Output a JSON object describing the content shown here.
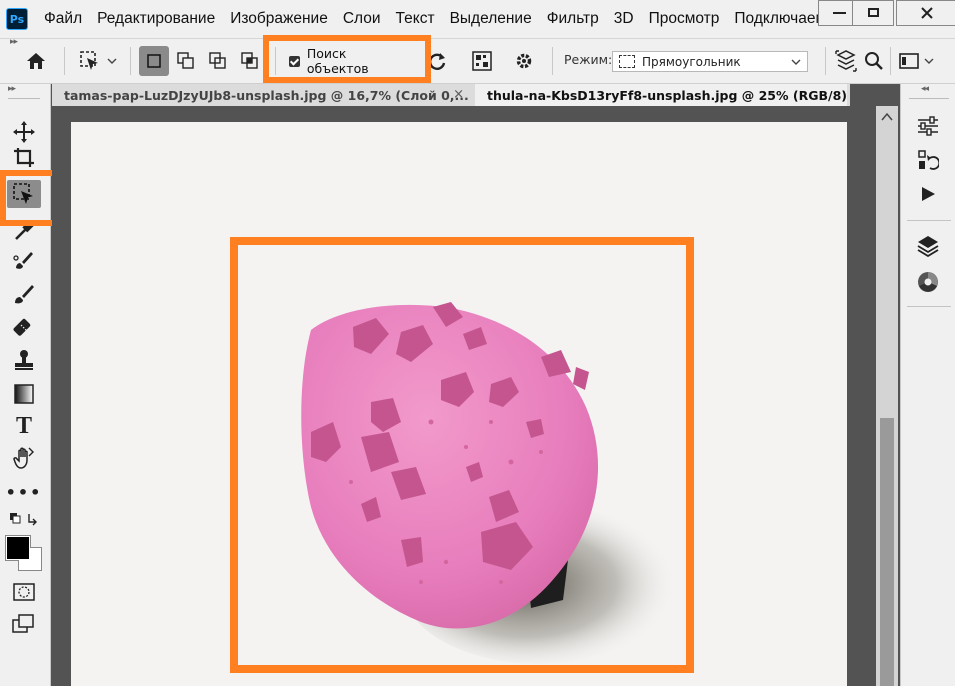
{
  "app": {
    "logo_text": "Ps"
  },
  "menu": [
    "Файл",
    "Редактирование",
    "Изображение",
    "Слои",
    "Текст",
    "Выделение",
    "Фильтр",
    "3D",
    "Просмотр",
    "Подключаемы"
  ],
  "options": {
    "object_finder_label": "Поиск объектов",
    "object_finder_checked": true,
    "mode_label": "Режим:",
    "mode_value": "Прямоугольник"
  },
  "tabs": [
    {
      "label": "tamas-pap-LuzDJzyUJb8-unsplash.jpg @ 16,7% (Слой 0,...",
      "active": false
    },
    {
      "label": "thula-na-KbsD13ryFf8-unsplash.jpg @ 25% (RGB/8)",
      "active": true
    }
  ],
  "highlight_color": "#ff7f21",
  "colors": {
    "foreground": "#000000",
    "background": "#ffffff",
    "object": "#e577b9"
  }
}
